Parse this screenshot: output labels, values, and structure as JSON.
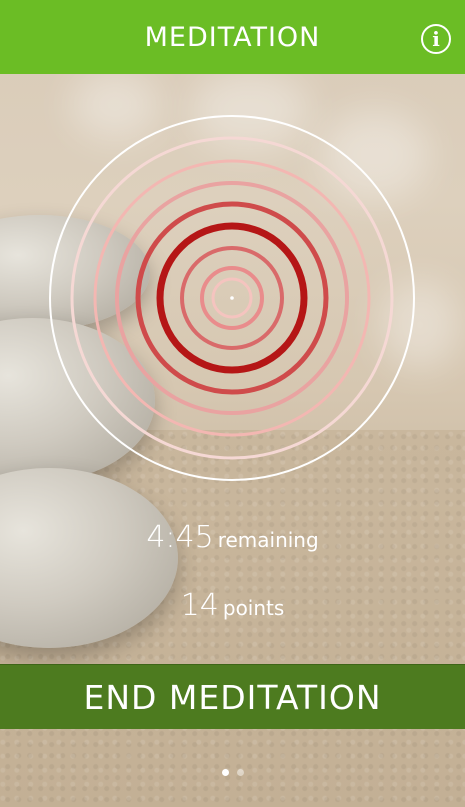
{
  "header": {
    "title": "MEDITATION",
    "info_icon": "info-icon",
    "info_glyph": "i"
  },
  "session": {
    "time_value": "4:45",
    "time_label": "remaining",
    "points_value": "14",
    "points_label": "points"
  },
  "actions": {
    "end_label": "END MEDITATION"
  },
  "pagination": {
    "total": 2,
    "active_index": 0
  },
  "colors": {
    "header_green": "#6bbd25",
    "button_green": "#4d7b1f",
    "ring_outer": "#ffffff",
    "ring_pink_light": "#f3b7b2",
    "ring_pink": "#e07b7b",
    "ring_red": "#b51616"
  }
}
